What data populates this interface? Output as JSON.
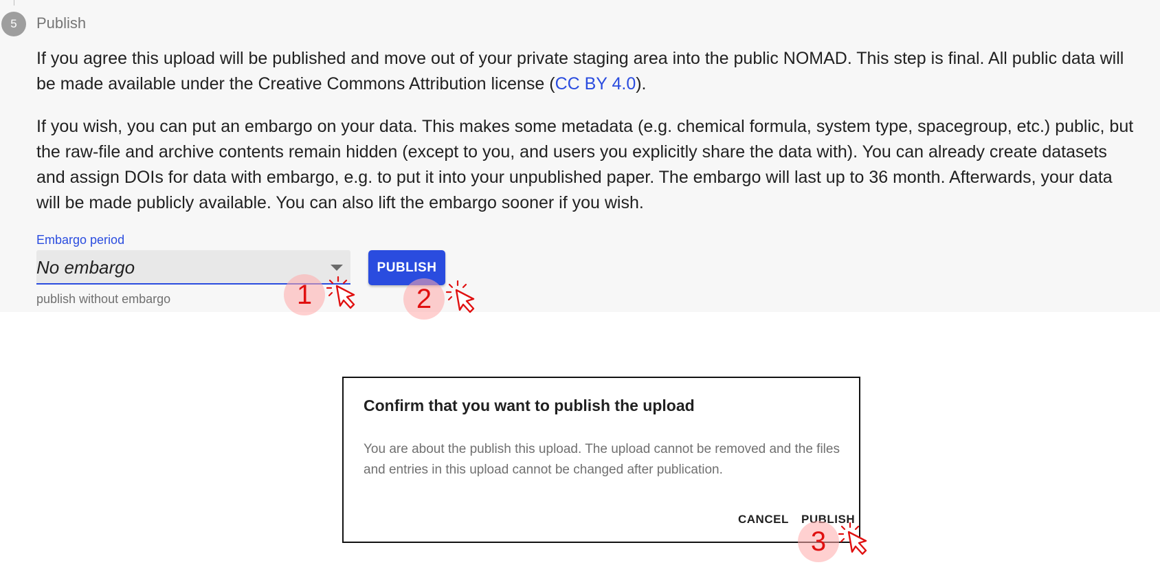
{
  "step": {
    "number": "5",
    "title": "Publish"
  },
  "description": {
    "p1_before_link": "If you agree this upload will be published and move out of your private staging area into the public NOMAD. This step is final. All public data will be made available under the Creative Commons Attribution license (",
    "p1_link": "CC BY 4.0",
    "p1_after_link": ").",
    "p2": "If you wish, you can put an embargo on your data. This makes some metadata (e.g. chemical formula, system type, spacegroup, etc.) public, but the raw-file and archive contents remain hidden (except to you, and users you explicitly share the data with). You can already create datasets and assign DOIs for data with embargo, e.g. to put it into your unpublished paper. The embargo will last up to 36 month. Afterwards, your data will be made publicly available. You can also lift the embargo sooner if you wish."
  },
  "embargo": {
    "label": "Embargo period",
    "selected": "No embargo",
    "helper": "publish without embargo"
  },
  "publish_button_label": "PUBLISH",
  "dialog": {
    "title": "Confirm that you want to publish the upload",
    "text": "You are about the publish this upload. The upload cannot be removed and the files and entries in this upload cannot be changed after publication.",
    "cancel_label": "CANCEL",
    "publish_label": "PUBLISH"
  },
  "annotations": {
    "marker1": "1",
    "marker2": "2",
    "marker3": "3",
    "color": "#e01010"
  },
  "colors": {
    "accent": "#2a4cdf",
    "panel_bg": "#f7f7f7",
    "step_circle": "#9e9e9e"
  }
}
